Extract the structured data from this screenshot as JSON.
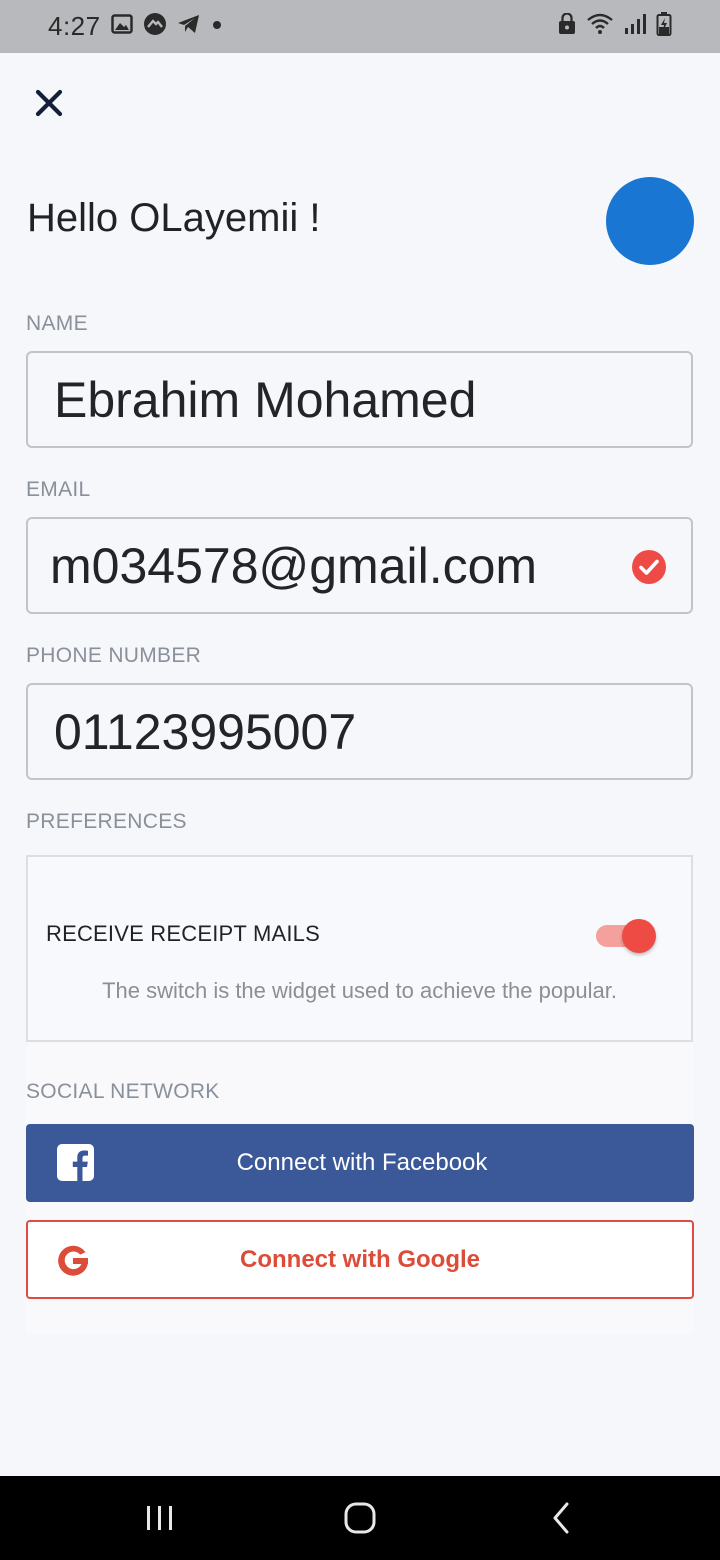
{
  "status_bar": {
    "time": "4:27",
    "left_icons": [
      "image-icon",
      "badge-icon",
      "telegram-icon",
      "dot-icon"
    ],
    "right_icons": [
      "lock-icon",
      "wifi-icon",
      "signal-icon",
      "battery-charging-icon"
    ]
  },
  "header": {
    "close_icon": "close-icon",
    "greeting": "Hello OLayemii !",
    "avatar_color": "#1976d2"
  },
  "form": {
    "name_label": "NAME",
    "name_value": "Ebrahim Mohamed",
    "email_label": "EMAIL",
    "email_value": "m034578@gmail.com",
    "email_valid_icon": "check-circle-icon",
    "phone_label": "PHONE NUMBER",
    "phone_value": "01123995007"
  },
  "preferences": {
    "section_label": "PREFERENCES",
    "receipt_title": "RECEIVE RECEIPT MAILS",
    "receipt_enabled": true,
    "description": "The switch is the widget used to achieve the popular."
  },
  "social": {
    "section_label": "SOCIAL NETWORK",
    "facebook_label": "Connect with Facebook",
    "facebook_color": "#3b5998",
    "google_label": "Connect with Google",
    "google_color": "#dd4b39"
  },
  "nav_bar": {
    "buttons": [
      "recent-apps-icon",
      "home-icon",
      "back-icon"
    ]
  }
}
